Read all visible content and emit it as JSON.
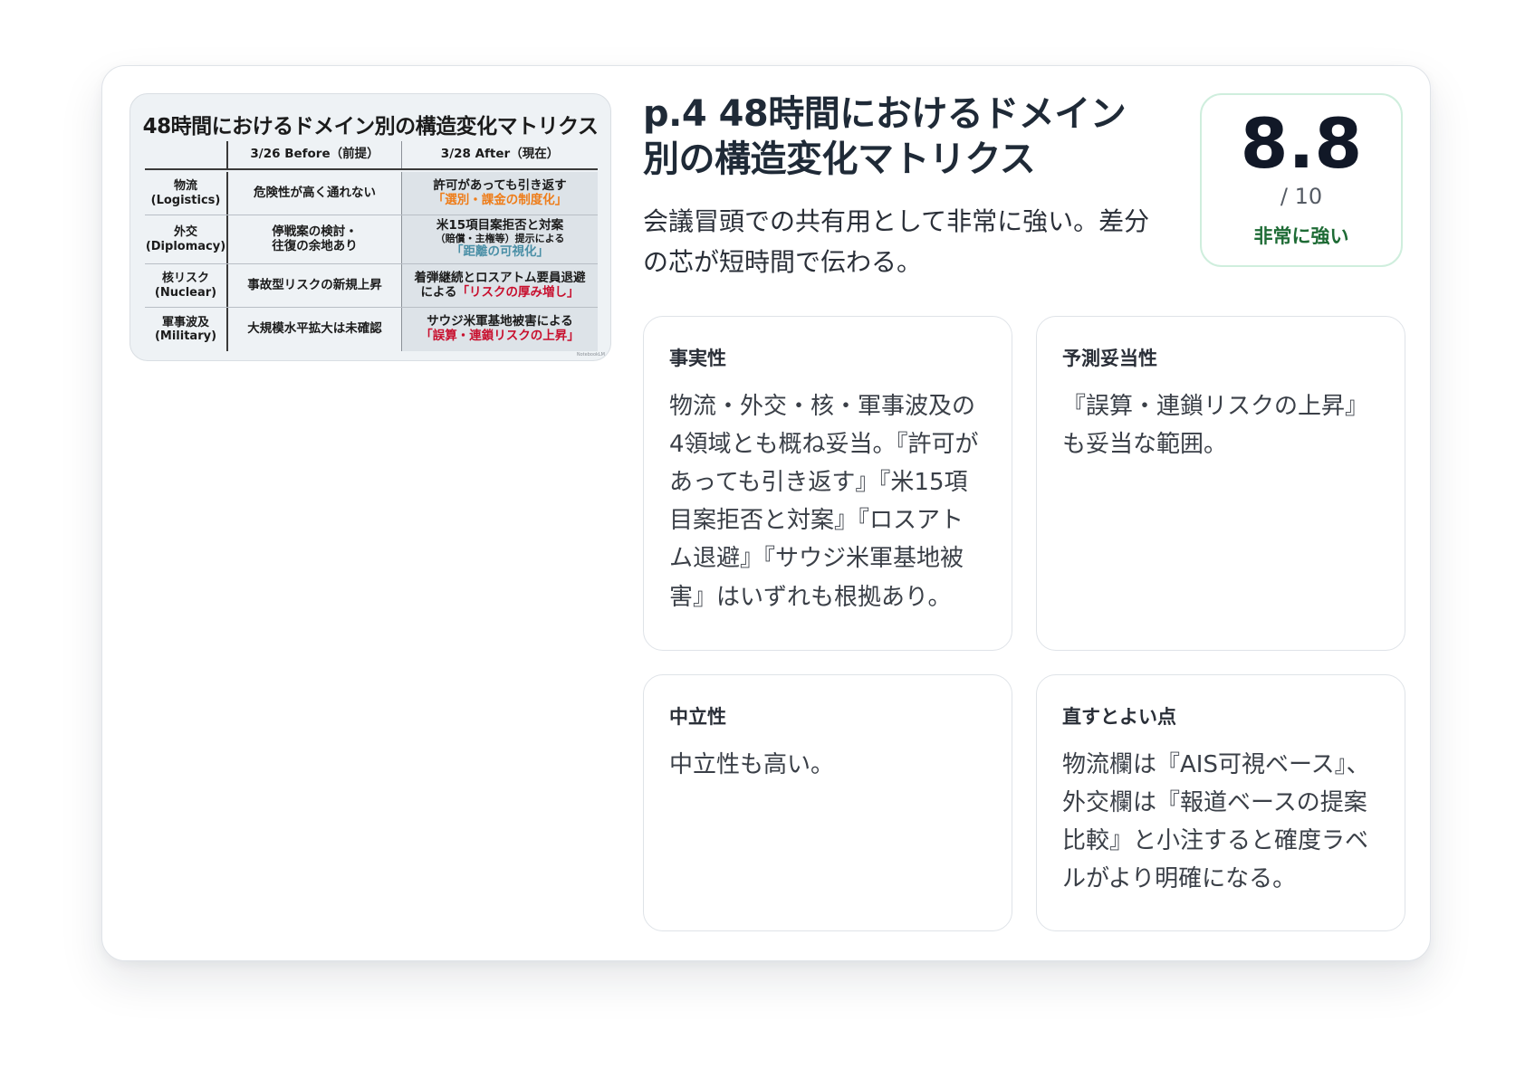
{
  "slide": {
    "title": "48時間におけるドメイン別の構造変化マトリクス",
    "columns": [
      "",
      "3/26 Before（前提）",
      "3/28 After（現在）"
    ],
    "rows": [
      {
        "domain": "物流",
        "domain_en": "(Logistics)",
        "before": "危険性が高く通れない",
        "after_1": "許可があっても引き返す",
        "after_hl": "「選別・課金の制度化」"
      },
      {
        "domain": "外交",
        "domain_en": "(Diplomacy)",
        "before_1": "停戦案の検討・",
        "before_2": "往復の余地あり",
        "after_1": "米15項目案拒否と対案",
        "after_2": "（賠償・主権等）提示による",
        "after_hl": "「距離の可視化」"
      },
      {
        "domain": "核リスク",
        "domain_en": "(Nuclear)",
        "before": "事故型リスクの新規上昇",
        "after_1": "着弾継続とロスアトム要員退避",
        "after_2": "による",
        "after_hl": "「リスクの厚み増し」"
      },
      {
        "domain": "軍事波及",
        "domain_en": "(Military)",
        "before": "大規模水平拡大は未確認",
        "after_1": "サウジ米軍基地被害による",
        "after_hl": "「誤算・連鎖リスクの上昇」"
      }
    ],
    "watermark": "NotebookLM",
    "colors": {
      "orange": "#ee7d1a",
      "blue": "#4a8fa6",
      "red": "#c8102e"
    }
  },
  "header": {
    "title": "p.4 48時間におけるドメイン別の構造変化マトリクス",
    "summary": "会議冒頭での共有用として非常に強い。差分の芯が短時間で伝わる。"
  },
  "score": {
    "value": "8.8",
    "max": "/ 10",
    "label": "非常に強い",
    "label_color": "#1e6b35",
    "border_color": "#cfeedd"
  },
  "panels": {
    "factuality": {
      "title": "事実性",
      "body": "物流・外交・核・軍事波及の4領域とも概ね妥当。『許可があっても引き返す』『米15項目案拒否と対案』『ロスアトム退避』『サウジ米軍基地被害』はいずれも根拠あり。"
    },
    "prediction": {
      "title": "予測妥当性",
      "body": "『誤算・連鎖リスクの上昇』も妥当な範囲。"
    },
    "neutrality": {
      "title": "中立性",
      "body": "中立性も高い。"
    },
    "improvements": {
      "title": "直すとよい点",
      "body": "物流欄は『AIS可視ベース』、外交欄は『報道ベースの提案比較』と小注すると確度ラベルがより明確になる。"
    }
  }
}
